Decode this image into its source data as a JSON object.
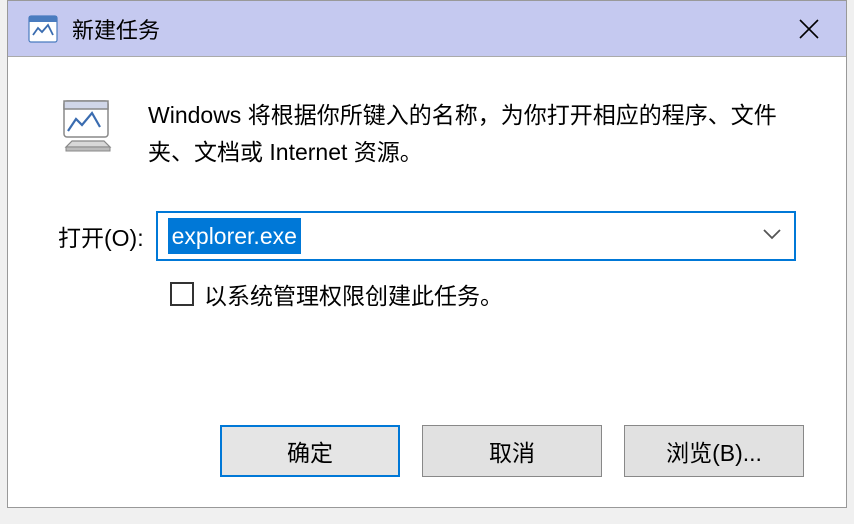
{
  "title": "新建任务",
  "description": "Windows 将根据你所键入的名称，为你打开相应的程序、文件夹、文档或 Internet 资源。",
  "openLabel": "打开(O):",
  "inputValue": "explorer.exe",
  "adminCheckbox": "以系统管理权限创建此任务。",
  "buttons": {
    "ok": "确定",
    "cancel": "取消",
    "browse": "浏览(B)..."
  }
}
